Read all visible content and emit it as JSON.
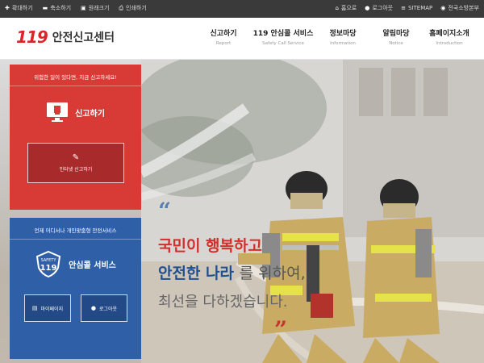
{
  "topbar": {
    "zoom_in": "확대하기",
    "zoom_out": "축소하기",
    "reset": "원래크기",
    "print": "인쇄하기",
    "home": "홈으로",
    "logout": "로그아웃",
    "sitemap": "SITEMAP",
    "hq": "전국소방본부"
  },
  "header": {
    "logo_mark": "119",
    "logo_text": "안전신고센터"
  },
  "nav": [
    {
      "label": "신고하기",
      "sub": "Report"
    },
    {
      "label": "119 안심콜 서비스",
      "sub": "Safety Call Service"
    },
    {
      "label": "정보마당",
      "sub": "Information"
    },
    {
      "label": "알림마당",
      "sub": "Notice"
    },
    {
      "label": "홈페이지소개",
      "sub": "Introduction"
    }
  ],
  "report_panel": {
    "note": "위험한 일이 있다면, 지금 신고하세요!",
    "title": "신고하기",
    "button": "인터넷 신고하기"
  },
  "safety_panel": {
    "note": "언제 어디서나 개인맞춤형 안전서비스",
    "title": "안심콜 서비스",
    "badge_text": "SAFETY",
    "badge_num": "119",
    "btn_mypage": "마이페이지",
    "btn_logout": "로그아웃"
  },
  "slogan": {
    "line1": "국민이 행복하고",
    "line2_bold": "안전한 나라",
    "line2_rest": "를 위하여,",
    "line3": "최선을 다하겠습니다."
  },
  "colors": {
    "red": "#d83a36",
    "blue": "#2f5fa6",
    "topbar": "#3a3a3a"
  }
}
